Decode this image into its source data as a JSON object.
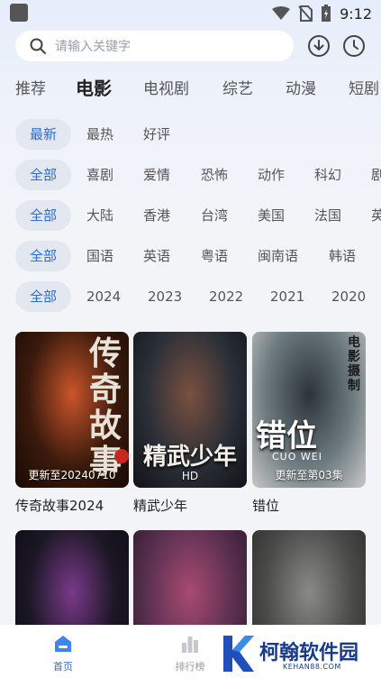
{
  "status_bar": {
    "time": "9:12"
  },
  "search": {
    "placeholder": "请输入关键字"
  },
  "category_tabs": [
    {
      "label": "推荐"
    },
    {
      "label": "电影"
    },
    {
      "label": "电视剧"
    },
    {
      "label": "综艺"
    },
    {
      "label": "动漫"
    },
    {
      "label": "短剧"
    }
  ],
  "filters": {
    "sort": [
      "最新",
      "最热",
      "好评"
    ],
    "genre": [
      "全部",
      "喜剧",
      "爱情",
      "恐怖",
      "动作",
      "科幻",
      "剧"
    ],
    "region": [
      "全部",
      "大陆",
      "香港",
      "台湾",
      "美国",
      "法国",
      "英"
    ],
    "language": [
      "全部",
      "国语",
      "英语",
      "粤语",
      "闽南语",
      "韩语"
    ],
    "year": [
      "全部",
      "2024",
      "2023",
      "2022",
      "2021",
      "2020"
    ]
  },
  "movies": [
    {
      "title": "传奇故事2024",
      "badge": "更新至20240710",
      "poster_text": "传奇故事",
      "poster_colors": [
        "#3a1a0c",
        "#c9552a",
        "#1a0a04"
      ]
    },
    {
      "title": "精武少年",
      "badge": "HD",
      "poster_text": "精武少年",
      "poster_colors": [
        "#2a2f38",
        "#7a5040",
        "#101317"
      ]
    },
    {
      "title": "错位",
      "badge": "更新至第03集",
      "poster_text": "错位",
      "poster_sub": "CUO WEI",
      "poster_corner": "电影摄制",
      "poster_colors": [
        "#6d7a80",
        "#2b3439",
        "#c8c8c4"
      ]
    },
    {
      "title": "",
      "badge": "",
      "poster_colors": [
        "#1a1624",
        "#7a3a8a",
        "#0e0b14"
      ]
    },
    {
      "title": "",
      "badge": "",
      "poster_colors": [
        "#5a3050",
        "#a84a70",
        "#2a1528"
      ]
    },
    {
      "title": "",
      "badge": "",
      "poster_colors": [
        "#4a4a48",
        "#8a8a86",
        "#2a2a28"
      ]
    }
  ],
  "bottom_nav": [
    {
      "label": "首页",
      "icon": "home-icon",
      "active": true
    },
    {
      "label": "排行榜",
      "icon": "ranking-icon",
      "active": false
    }
  ],
  "watermark": {
    "title": "柯翰软件园",
    "subtitle": "KEHAN88.COM"
  },
  "colors": {
    "accent": "#2b6bd6",
    "chip_bg": "#e3e8f0",
    "watermark": "#173a8c"
  }
}
